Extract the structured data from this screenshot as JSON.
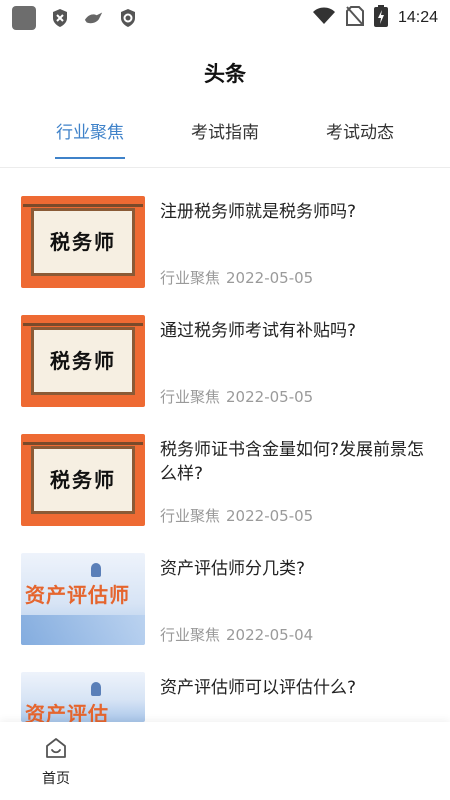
{
  "status_bar": {
    "time": "14:24",
    "left_icons": [
      "app-square-icon",
      "shield-x-icon",
      "bird-icon",
      "shield-check-icon"
    ],
    "right_icons": [
      "wifi-icon",
      "no-sim-icon",
      "battery-charging-icon"
    ]
  },
  "header": {
    "title": "头条"
  },
  "tabs": [
    {
      "label": "行业聚焦",
      "active": true
    },
    {
      "label": "考试指南",
      "active": false
    },
    {
      "label": "考试动态",
      "active": false
    }
  ],
  "articles": [
    {
      "thumb_text": "税务师",
      "thumb_type": "tax",
      "title": "注册税务师就是税务师吗?",
      "category": "行业聚焦",
      "date": "2022-05-05"
    },
    {
      "thumb_text": "税务师",
      "thumb_type": "tax",
      "title": "通过税务师考试有补贴吗?",
      "category": "行业聚焦",
      "date": "2022-05-05"
    },
    {
      "thumb_text": "税务师",
      "thumb_type": "tax",
      "title": "税务师证书含金量如何?发展前景怎么样?",
      "category": "行业聚焦",
      "date": "2022-05-05"
    },
    {
      "thumb_text": "资产评估师",
      "thumb_type": "asset",
      "title": "资产评估师分几类?",
      "category": "行业聚焦",
      "date": "2022-05-04"
    },
    {
      "thumb_text": "资产评估",
      "thumb_type": "asset",
      "title": "资产评估师可以评估什么?",
      "category": "",
      "date": ""
    }
  ],
  "bottom_nav": {
    "home_label": "首页"
  },
  "colors": {
    "accent": "#3f82c9",
    "tax_thumb_bg": "#ee6a33",
    "meta_text": "#9a9a9a"
  }
}
